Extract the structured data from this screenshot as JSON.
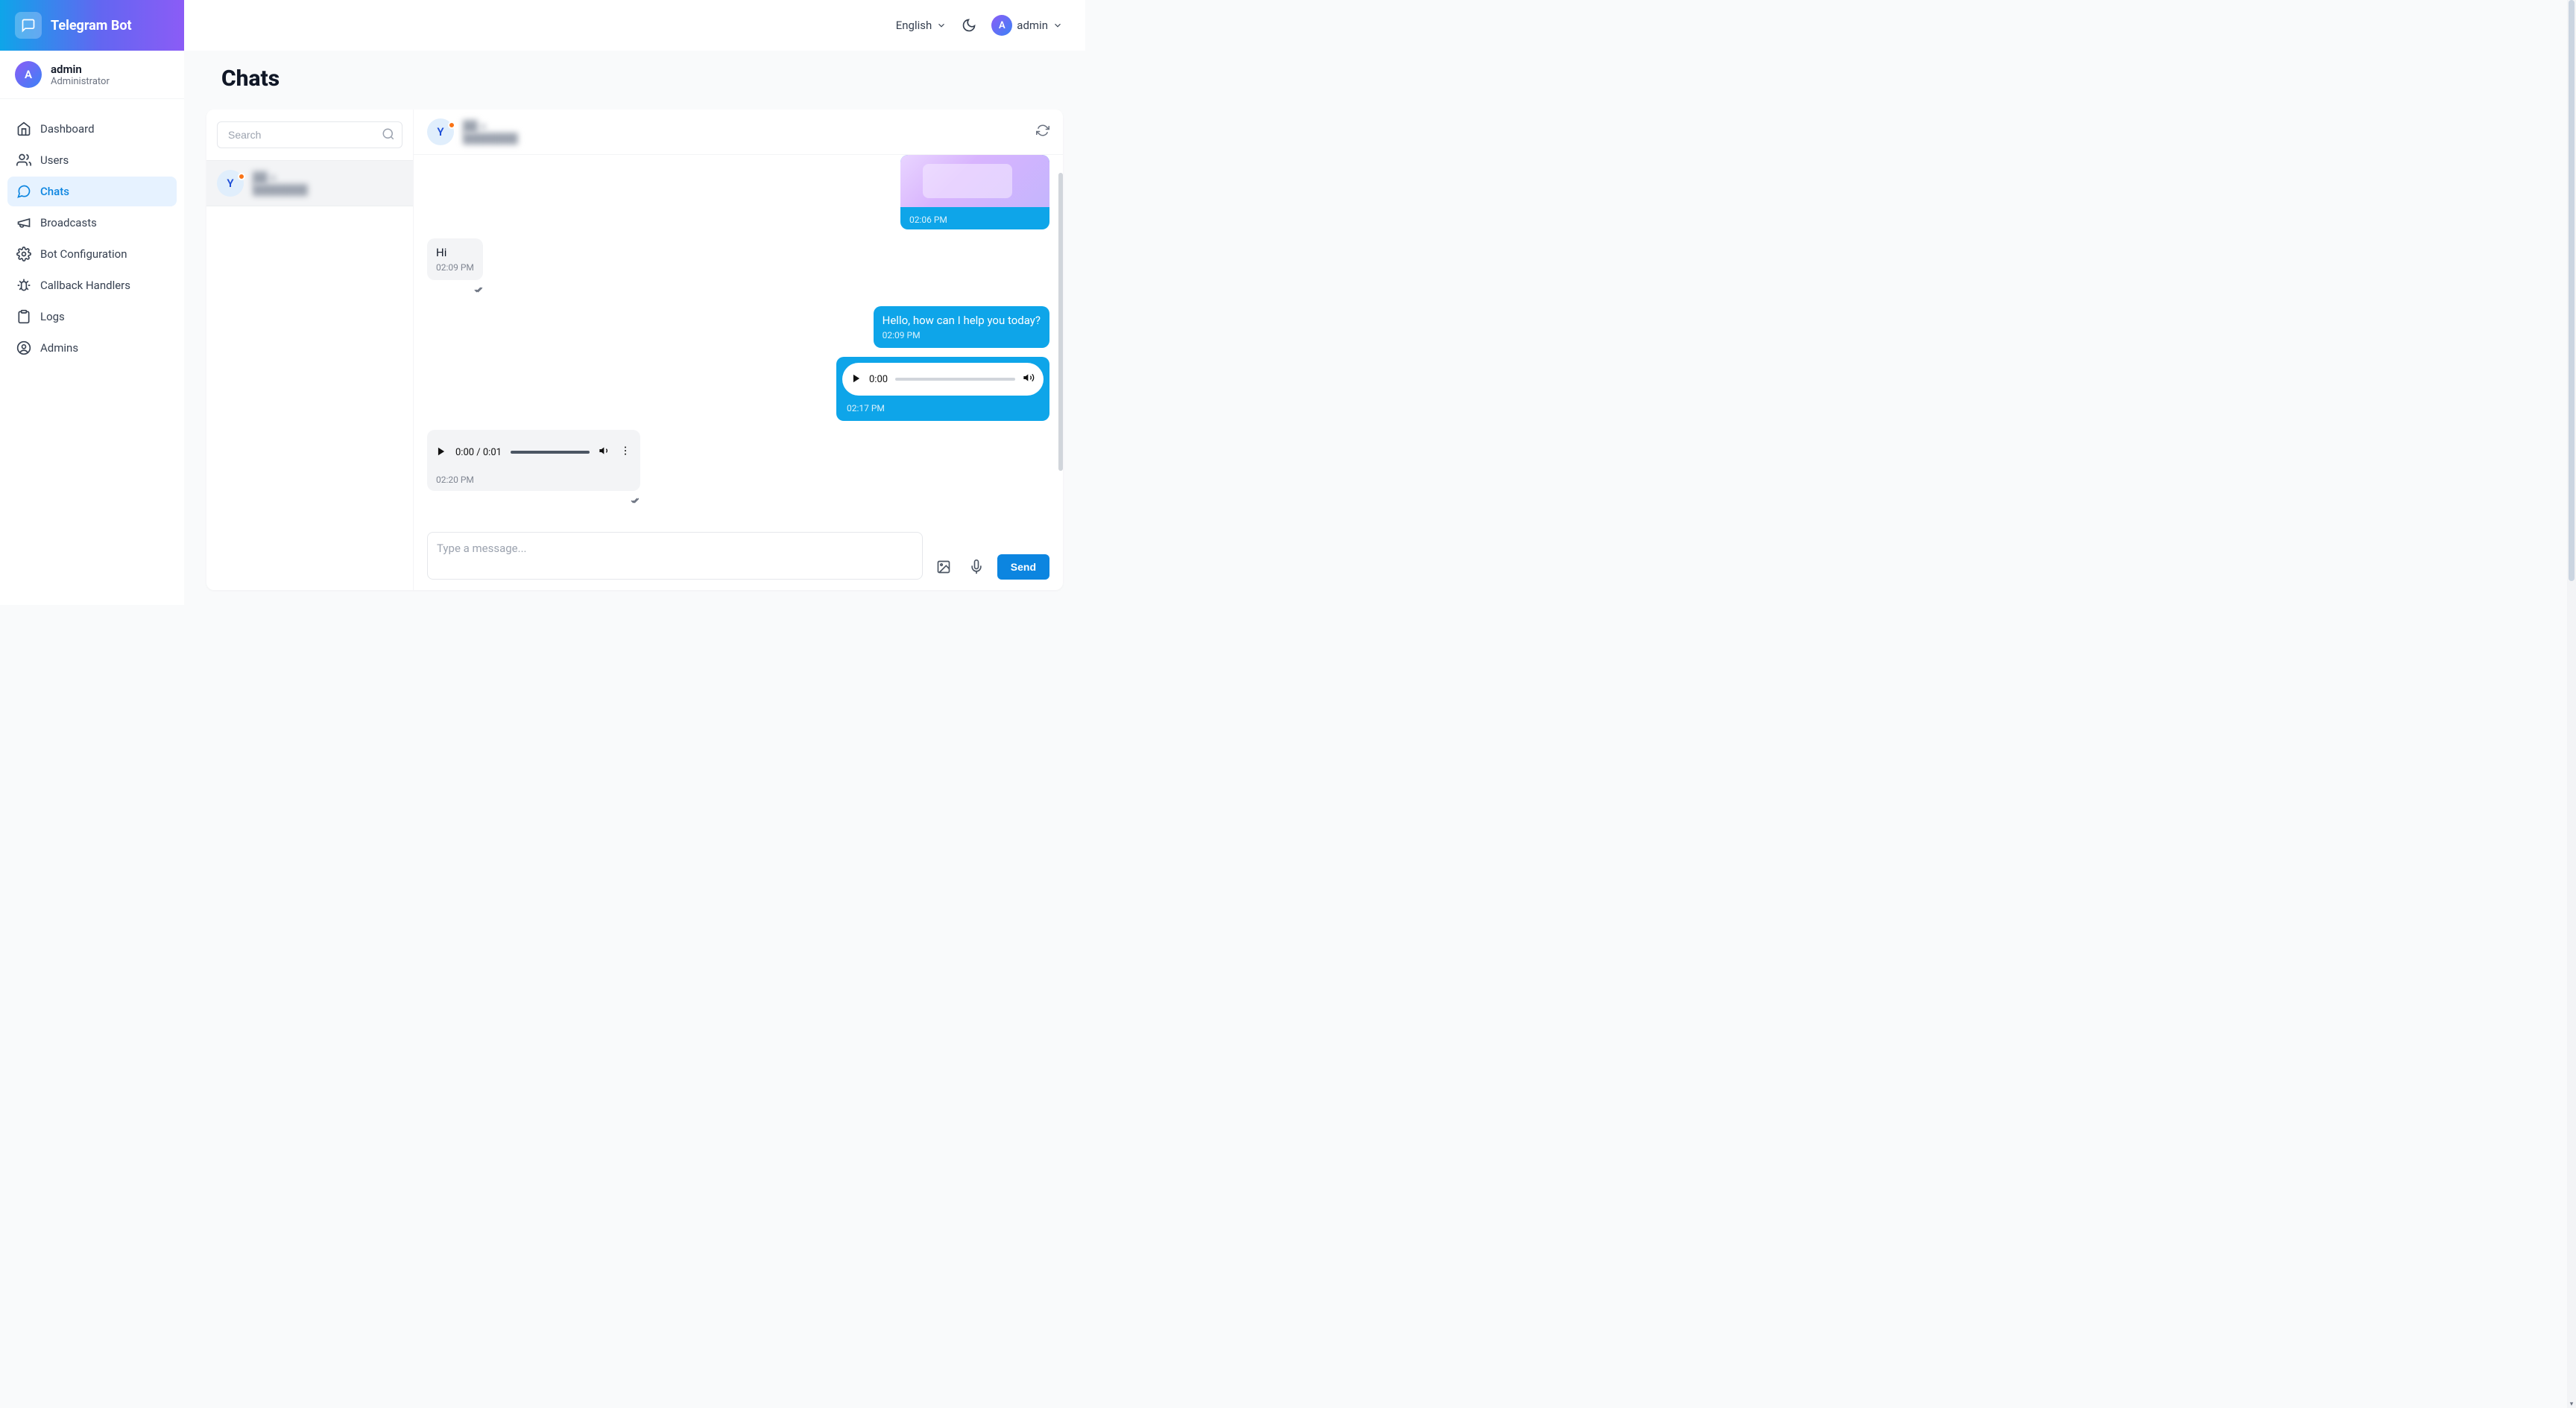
{
  "brand": {
    "title": "Telegram Bot"
  },
  "profile": {
    "initial": "A",
    "name": "admin",
    "role": "Administrator"
  },
  "sidebar": {
    "items": [
      {
        "label": "Dashboard"
      },
      {
        "label": "Users"
      },
      {
        "label": "Chats"
      },
      {
        "label": "Broadcasts"
      },
      {
        "label": "Bot Configuration"
      },
      {
        "label": "Callback Handlers"
      },
      {
        "label": "Logs"
      },
      {
        "label": "Admins"
      }
    ]
  },
  "topbar": {
    "language": "English",
    "userInitial": "A",
    "userName": "admin"
  },
  "page": {
    "title": "Chats"
  },
  "chatList": {
    "searchPlaceholder": "Search",
    "items": [
      {
        "initial": "Y",
        "name": "██ ●",
        "sub": "████████"
      }
    ]
  },
  "conversation": {
    "header": {
      "initial": "Y",
      "name": "██ ●",
      "sub": "████████"
    },
    "messages": {
      "img1_time": "02:06 PM",
      "in1_text": "Hi",
      "in1_time": "02:09 PM",
      "out1_text": "Hello, how can I help you today?",
      "out1_time": "02:09 PM",
      "audioOut_time": "02:17 PM",
      "audioOut_pos": "0:00",
      "audioIn_time": "02:20 PM",
      "audioIn_pos": "0:00 / 0:01"
    },
    "composer": {
      "placeholder": "Type a message...",
      "send": "Send"
    }
  }
}
